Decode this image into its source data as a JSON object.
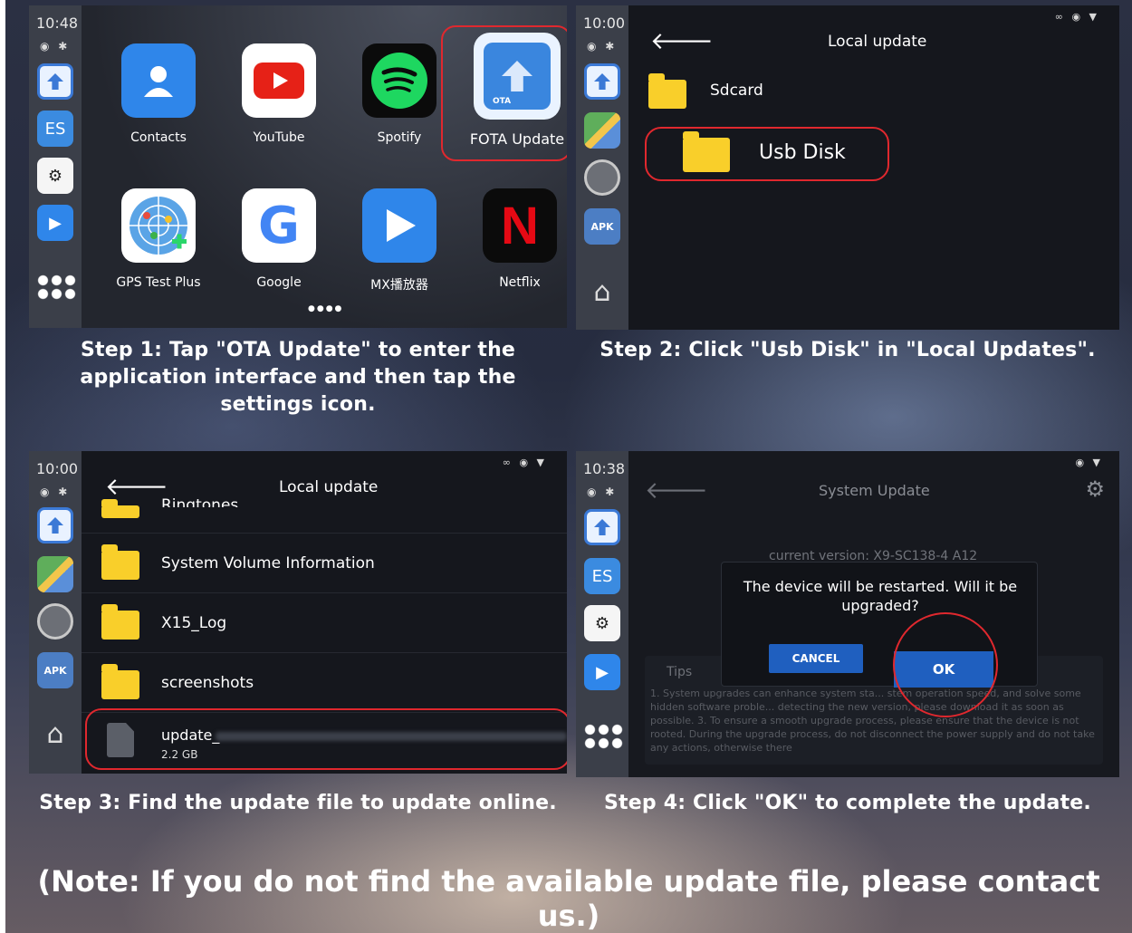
{
  "panel1": {
    "time": "10:48",
    "apps": [
      {
        "label": "Contacts"
      },
      {
        "label": "YouTube"
      },
      {
        "label": "Spotify"
      },
      {
        "label": "FOTA Update",
        "badge": "OTA"
      },
      {
        "label": "GPS Test Plus"
      },
      {
        "label": "Google",
        "glyph": "G"
      },
      {
        "label": "MX播放器"
      },
      {
        "label": "Netflix",
        "glyph": "N"
      }
    ],
    "page_dots": "●●●●"
  },
  "panel2": {
    "time": "10:00",
    "title": "Local update",
    "items": [
      {
        "label": "Sdcard"
      },
      {
        "label": "Usb Disk"
      }
    ],
    "apk": "APK"
  },
  "panel3": {
    "time": "10:00",
    "title": "Local update",
    "partial_item": "Ringtones",
    "items": [
      {
        "label": "System Volume Information"
      },
      {
        "label": "X15_Log"
      },
      {
        "label": "screenshots"
      }
    ],
    "file": {
      "name": "update_",
      "size": "2.2 GB"
    },
    "apk": "APK"
  },
  "panel4": {
    "time": "10:38",
    "title": "System Update",
    "current_version": "current version: X9-SC138-4 A12",
    "dialog_message": "The device will be restarted. Will it be upgraded?",
    "cancel": "CANCEL",
    "ok": "OK",
    "tips_title": "Tips",
    "tips_text": "1. System upgrades can enhance system sta... stem operation speed, and solve some hidden software proble... detecting the new version, please download it as soon as possible. 3. To ensure a smooth upgrade process, please ensure that the device is not rooted. During the upgrade process, do not disconnect the power supply and do not take any actions, otherwise there"
  },
  "captions": {
    "step1": "Step 1: Tap \"OTA Update\" to enter the application interface and then tap the settings icon.",
    "step2": "Step 2: Click \"Usb Disk\" in \"Local Updates\".",
    "step3": "Step 3: Find the update file to update online.",
    "step4": "Step 4: Click \"OK\" to complete the update.",
    "note": "(Note: If you do not find the available update file, please contact us.)"
  },
  "colors": {
    "accent_red": "#e0282e",
    "folder": "#f9cf2a",
    "dialog_button": "#1f5fbf"
  }
}
